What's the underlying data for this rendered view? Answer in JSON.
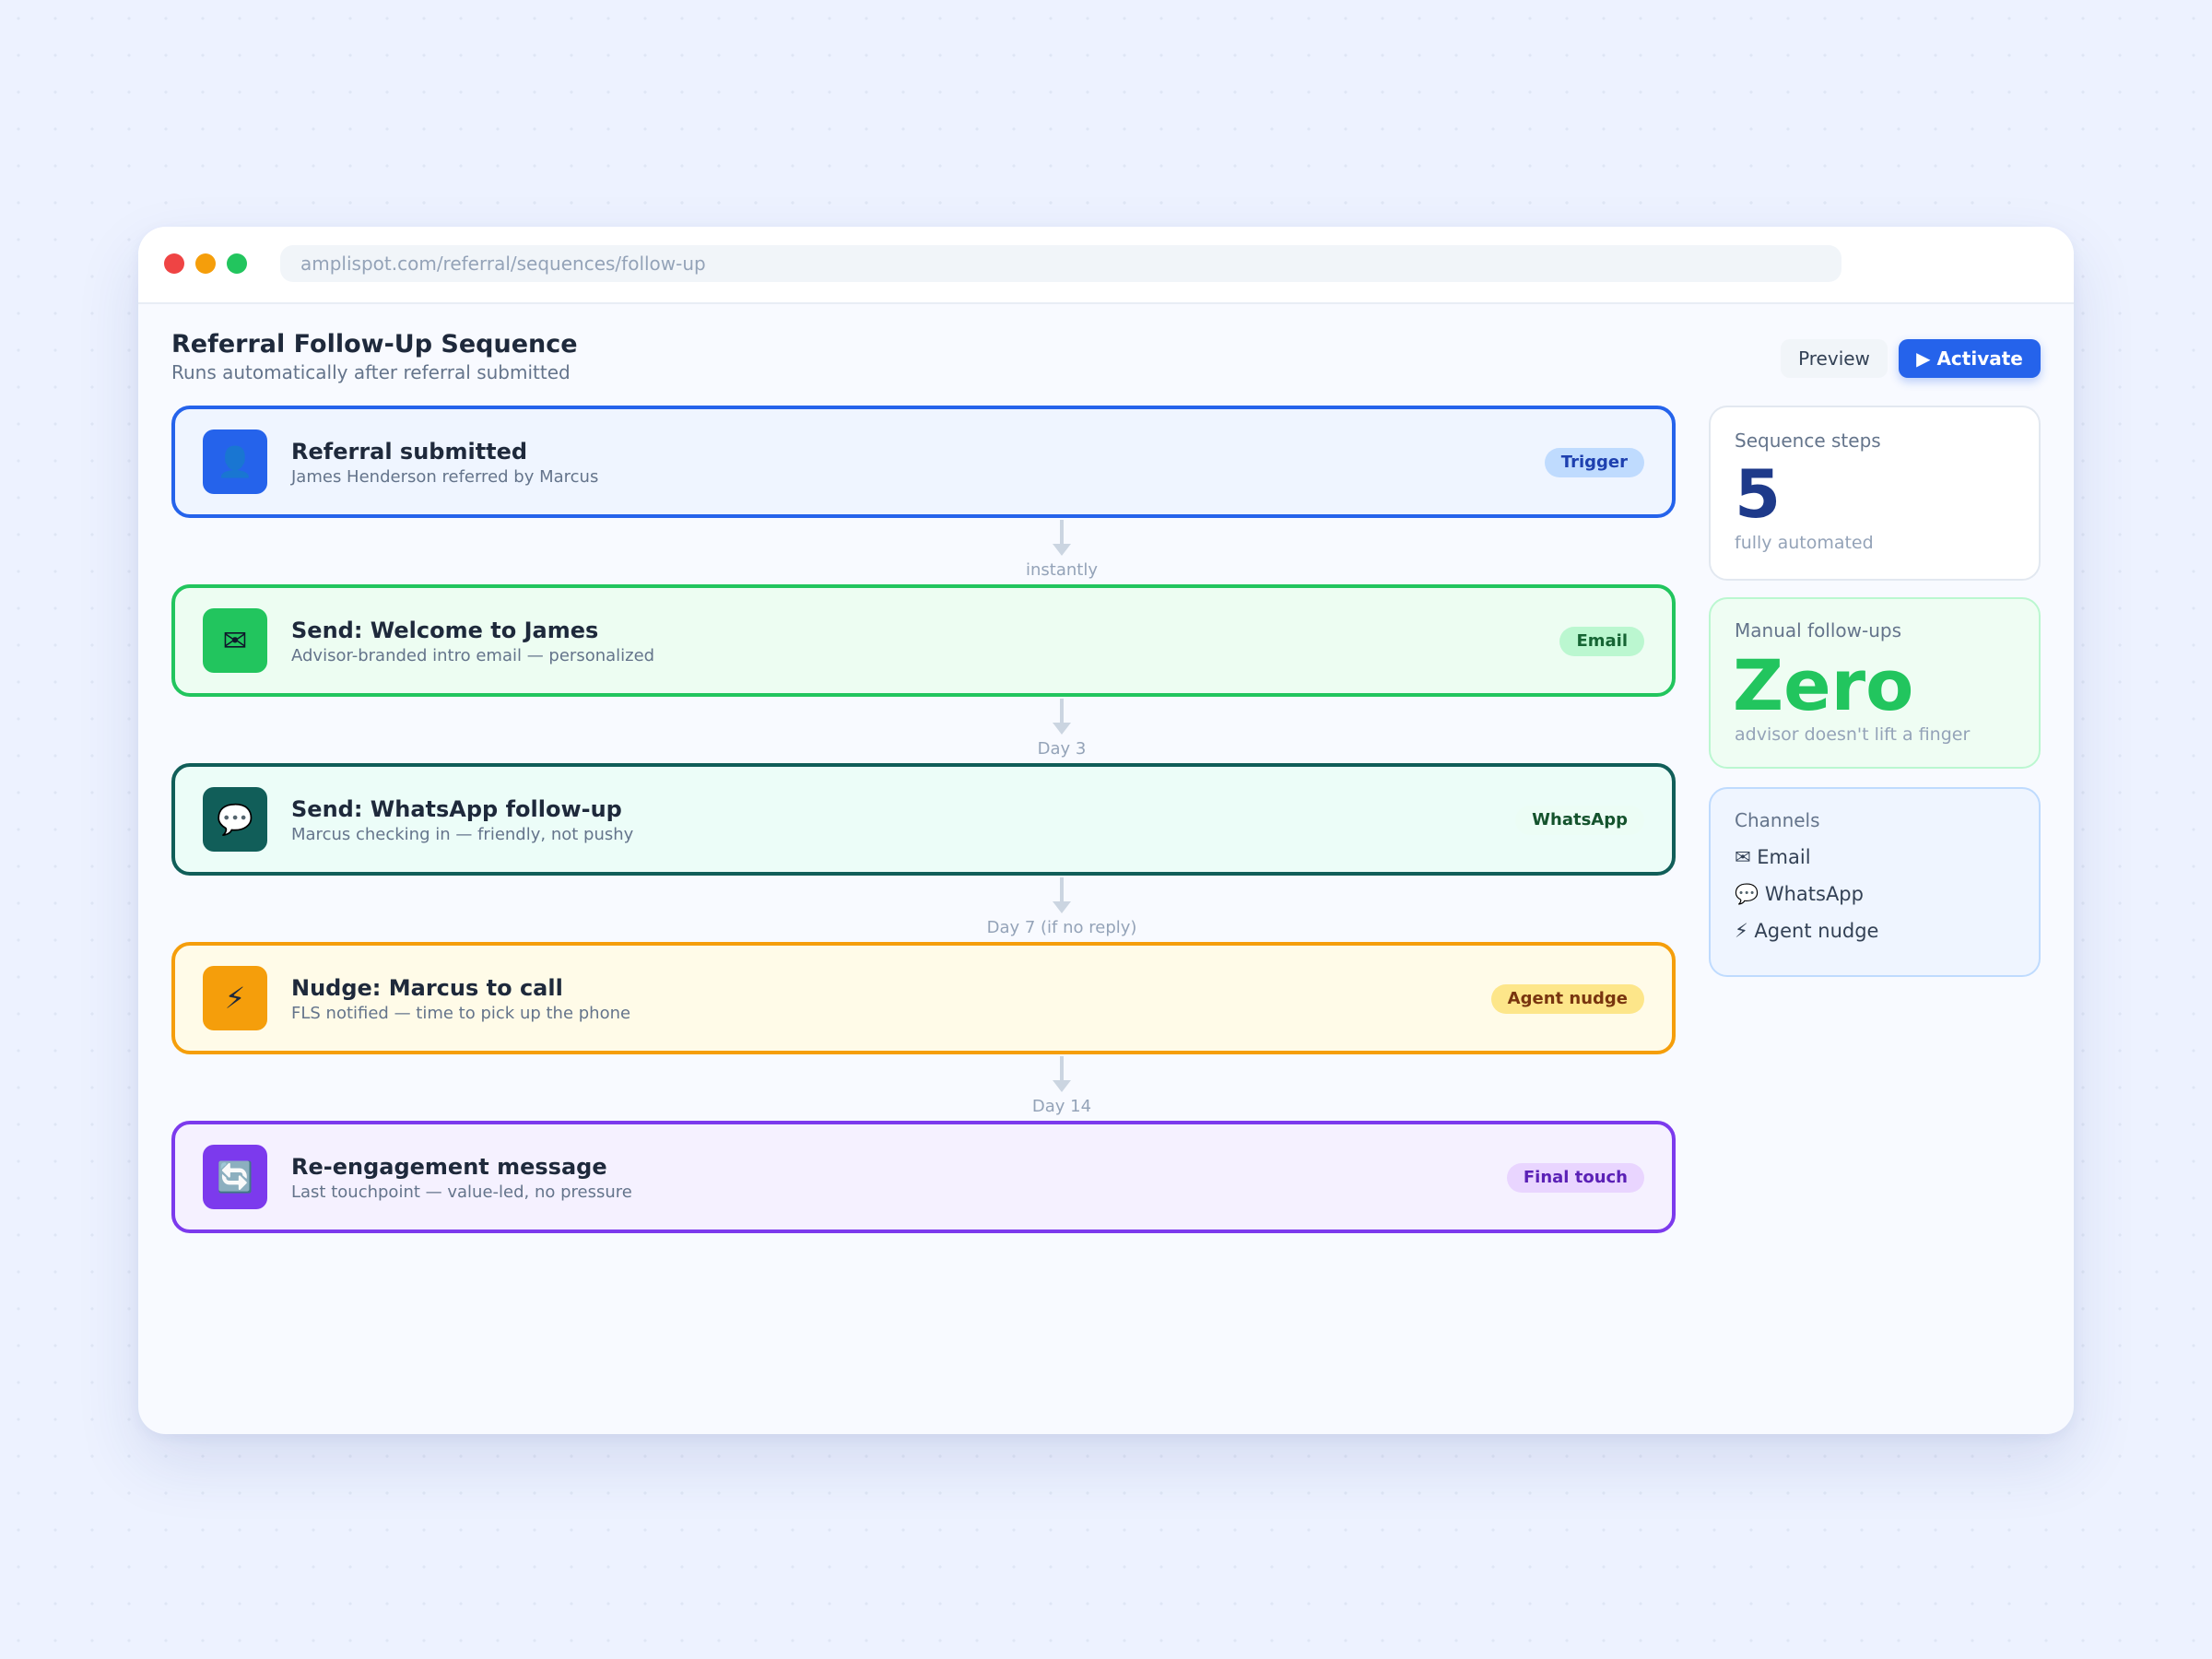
{
  "browser": {
    "url": "amplispot.com/referral/sequences/follow-up"
  },
  "header": {
    "title": "Referral Follow-Up Sequence",
    "subtitle": "Runs automatically after referral submitted",
    "preview_label": "Preview",
    "activate_label": "▶ Activate"
  },
  "steps": [
    {
      "icon": "user-icon",
      "glyph": "👤",
      "title": "Referral submitted",
      "description": "James Henderson referred by Marcus",
      "tag": "Trigger",
      "color": "#2563eb"
    },
    {
      "icon": "envelope-icon",
      "glyph": "✉",
      "title": "Send: Welcome to James",
      "description": "Advisor-branded intro email — personalized",
      "tag": "Email",
      "color": "#22c55e"
    },
    {
      "icon": "chat-bubble-icon",
      "glyph": "💬",
      "title": "Send: WhatsApp follow-up",
      "description": "Marcus checking in — friendly, not pushy",
      "tag": "WhatsApp",
      "color": "#115e59"
    },
    {
      "icon": "lightning-icon",
      "glyph": "⚡",
      "title": "Nudge: Marcus to call",
      "description": "FLS notified — time to pick up the phone",
      "tag": "Agent nudge",
      "color": "#f59e0b"
    },
    {
      "icon": "refresh-icon",
      "glyph": "🔄",
      "title": "Re-engagement message",
      "description": "Last touchpoint — value-led, no pressure",
      "tag": "Final touch",
      "color": "#7c3aed"
    }
  ],
  "delays": [
    "instantly",
    "Day 3",
    "Day 7 (if no reply)",
    "Day 14"
  ],
  "stats": {
    "steps_label": "Sequence steps",
    "steps_value": "5",
    "steps_note": "fully automated",
    "manual_label": "Manual follow-ups",
    "manual_value": "Zero",
    "manual_note": "advisor doesn't lift a finger"
  },
  "channels": {
    "label": "Channels",
    "items": [
      "✉ Email",
      "💬 WhatsApp",
      "⚡ Agent nudge"
    ]
  }
}
